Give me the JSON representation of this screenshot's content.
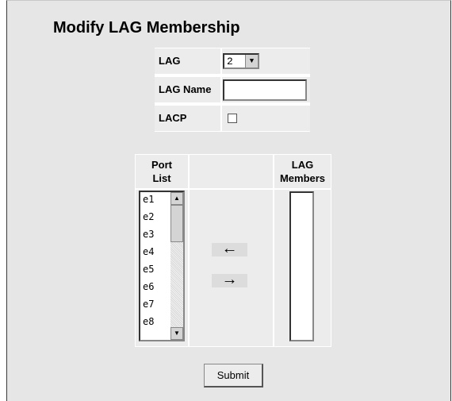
{
  "page": {
    "title": "Modify LAG Membership"
  },
  "form": {
    "lag_label": "LAG",
    "lag_value": "2",
    "lag_name_label": "LAG Name",
    "lag_name_value": "",
    "lacp_label": "LACP",
    "lacp_checked": false
  },
  "ports": {
    "port_list_header": "Port List",
    "lag_members_header": "LAG Members",
    "port_list_items": [
      "e1",
      "e2",
      "e3",
      "e4",
      "e5",
      "e6",
      "e7",
      "e8"
    ],
    "lag_members_items": [],
    "add_arrow": "←",
    "remove_arrow": "→"
  },
  "actions": {
    "submit_label": "Submit"
  },
  "icons": {
    "scroll_up": "triangle-up-icon",
    "scroll_down": "triangle-down-icon",
    "dropdown": "triangle-down-icon"
  }
}
